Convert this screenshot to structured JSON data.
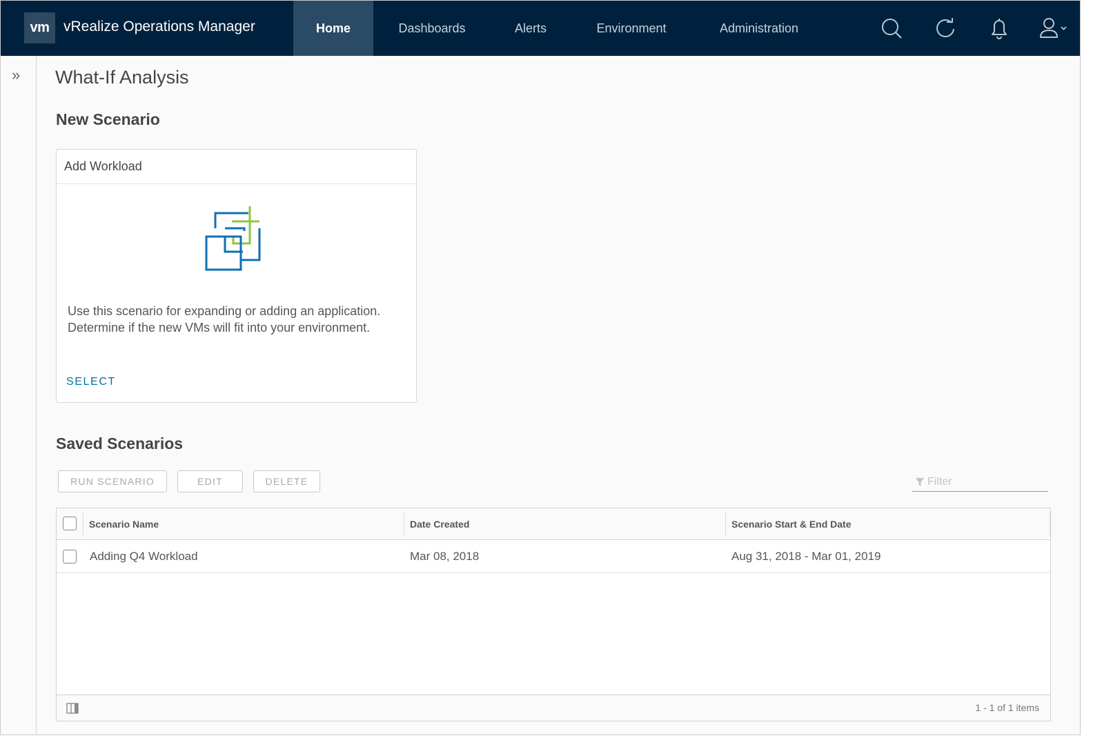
{
  "header": {
    "logo": "vm",
    "title": "vRealize Operations Manager",
    "nav": [
      {
        "label": "Home",
        "active": true
      },
      {
        "label": "Dashboards",
        "active": false
      },
      {
        "label": "Alerts",
        "active": false
      },
      {
        "label": "Environment",
        "active": false
      },
      {
        "label": "Administration",
        "active": false
      }
    ],
    "icons": [
      "search-icon",
      "refresh-icon",
      "bell-icon",
      "user-icon",
      "chevron-down-icon"
    ]
  },
  "sidebar": {
    "toggle_glyph": "»"
  },
  "page": {
    "title": "What-If Analysis",
    "new_scenario_title": "New Scenario",
    "saved_scenarios_title": "Saved Scenarios"
  },
  "card": {
    "title": "Add Workload",
    "description": "Use this scenario for expanding or adding an application. Determine if the new VMs will fit into your environment.",
    "action": "SELECT",
    "illustration": "add-workload-icon"
  },
  "toolbar": {
    "run_label": "RUN SCENARIO",
    "edit_label": "EDIT",
    "delete_label": "DELETE",
    "filter_placeholder": "Filter"
  },
  "grid": {
    "columns": [
      "Scenario Name",
      "Date Created",
      "Scenario Start & End Date"
    ],
    "rows": [
      {
        "name": "Adding Q4 Workload",
        "date_created": "Mar 08, 2018",
        "range": "Aug 31, 2018 - Mar 01, 2019"
      }
    ],
    "pagination": "1 - 1 of 1 items"
  },
  "colors": {
    "header_bg": "#00213d",
    "nav_active_bg": "#2a4a66",
    "link": "#0072a3",
    "icon_blue": "#0f6fb5",
    "icon_green": "#8cc63f"
  }
}
